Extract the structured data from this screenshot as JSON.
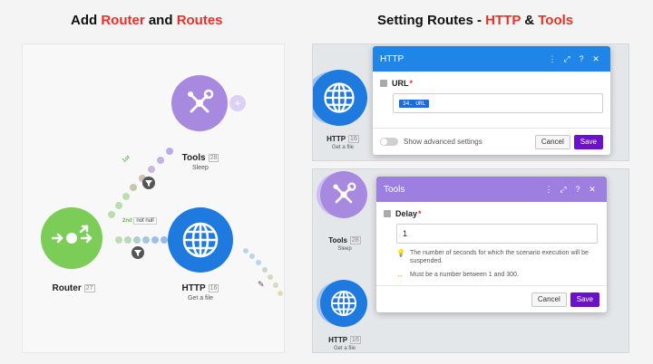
{
  "headings": {
    "left": {
      "prefix": "Add ",
      "router": "Router",
      "mid": " and ",
      "routes": "Routes"
    },
    "right": {
      "prefix": "Setting Routes - ",
      "http": "HTTP",
      "amp": " & ",
      "tools": "Tools"
    }
  },
  "colors": {
    "accent_red": "#e8302a",
    "router_green": "#7ccd58",
    "tools_purple": "#a889e0",
    "http_blue": "#1f7ae0",
    "save_purple": "#6a11c9",
    "http_header": "#1f86e8",
    "tools_header": "#9c7fe0"
  },
  "canvas": {
    "tools": {
      "name": "Tools",
      "id": "28",
      "sub": "Sleep",
      "icon": "tools-icon"
    },
    "router": {
      "name": "Router",
      "id": "27",
      "icon": "router-icon"
    },
    "http": {
      "name": "HTTP",
      "id": "16",
      "sub": "Get a file",
      "icon": "globe-icon"
    },
    "route1": {
      "nth": "1st"
    },
    "route2": {
      "nth": "2nd",
      "label": "not null"
    }
  },
  "http_dialog": {
    "title": "HTTP",
    "module": {
      "name": "HTTP",
      "id": "16",
      "sub": "Get a file"
    },
    "field_label": "URL",
    "required": "*",
    "value_pill": "34. URL",
    "toggle_label": "Show advanced settings",
    "cancel": "Cancel",
    "save": "Save",
    "header_buttons": [
      "⋮",
      "⤢",
      "?",
      "✕"
    ]
  },
  "tools_dialog": {
    "title": "Tools",
    "module_top": {
      "name": "Tools",
      "id": "28",
      "sub": "Sleep"
    },
    "module_bottom": {
      "name": "HTTP",
      "id": "16",
      "sub": "Get a file"
    },
    "field_label": "Delay",
    "required": "*",
    "value": "1",
    "hint1": "The number of seconds for which the scenario execution will be suspended.",
    "hint2": "Must be a number between 1 and 300.",
    "cancel": "Cancel",
    "save": "Save",
    "header_buttons": [
      "⋮",
      "⤢",
      "?",
      "✕"
    ]
  }
}
